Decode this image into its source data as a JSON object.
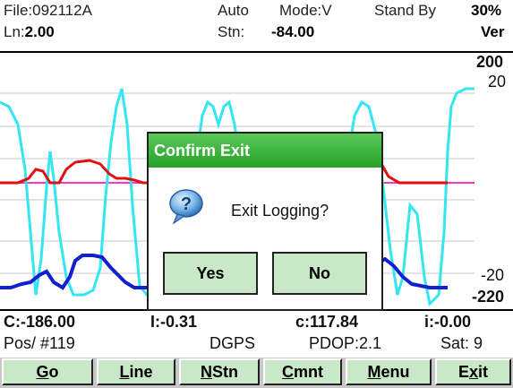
{
  "header": {
    "file_label": "File:",
    "file_value": "092112A",
    "auto": "Auto",
    "mode": "Mode:V",
    "status": "Stand By",
    "percent": "30%",
    "ln_label": "Ln:",
    "ln_value": "2.00",
    "stn_label": "Stn:",
    "stn_value": "-84.00",
    "ver": "Ver"
  },
  "plot": {
    "y_labels": [
      "200",
      "20",
      "-20",
      "-220"
    ],
    "colors": {
      "cyan": "#33e6f2",
      "red": "#e01010",
      "magenta": "#ff33cc",
      "blue": "#1020d0",
      "grid": "#c8c8c8"
    }
  },
  "stats": {
    "c_upper": "C:-186.00",
    "i_upper": "I:-0.31",
    "c_lower": "c:117.84",
    "i_lower": "i:-0.00",
    "pos": "Pos/ #119",
    "dgps": "DGPS",
    "pdop": "PDOP:2.1",
    "sat": "Sat: 9"
  },
  "buttons": [
    {
      "pre": "",
      "u": "G",
      "post": "o"
    },
    {
      "pre": "",
      "u": "L",
      "post": "ine"
    },
    {
      "pre": "",
      "u": "N",
      "post": "Stn"
    },
    {
      "pre": "",
      "u": "C",
      "post": "mnt"
    },
    {
      "pre": "",
      "u": "M",
      "post": "enu"
    },
    {
      "pre": "E",
      "u": "x",
      "post": "it"
    }
  ],
  "dialog": {
    "title": "Confirm Exit",
    "message": "Exit Logging?",
    "yes": "Yes",
    "no": "No",
    "icon": "question-icon"
  }
}
